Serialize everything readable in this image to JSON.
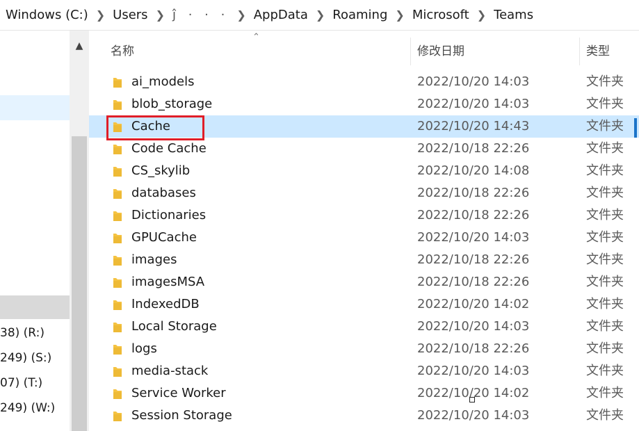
{
  "breadcrumb": [
    {
      "label": "Windows (C:)"
    },
    {
      "label": "Users"
    },
    {
      "label": "ĵ · · ·"
    },
    {
      "label": "AppData"
    },
    {
      "label": "Roaming"
    },
    {
      "label": "Microsoft"
    },
    {
      "label": "Teams"
    }
  ],
  "nav": {
    "items": [
      {
        "label": "38) (R:)"
      },
      {
        "label": "249) (S:)"
      },
      {
        "label": "07) (T:)"
      },
      {
        "label": "249) (W:)"
      }
    ]
  },
  "columns": {
    "name": "名称",
    "date": "修改日期",
    "type": "类型"
  },
  "files": [
    {
      "name": "ai_models",
      "date": "2022/10/20 14:03",
      "type": "文件夹"
    },
    {
      "name": "blob_storage",
      "date": "2022/10/20 14:03",
      "type": "文件夹"
    },
    {
      "name": "Cache",
      "date": "2022/10/20 14:43",
      "type": "文件夹"
    },
    {
      "name": "Code Cache",
      "date": "2022/10/18 22:26",
      "type": "文件夹"
    },
    {
      "name": "CS_skylib",
      "date": "2022/10/20 14:08",
      "type": "文件夹"
    },
    {
      "name": "databases",
      "date": "2022/10/18 22:26",
      "type": "文件夹"
    },
    {
      "name": "Dictionaries",
      "date": "2022/10/18 22:26",
      "type": "文件夹"
    },
    {
      "name": "GPUCache",
      "date": "2022/10/20 14:03",
      "type": "文件夹"
    },
    {
      "name": "images",
      "date": "2022/10/18 22:26",
      "type": "文件夹"
    },
    {
      "name": "imagesMSA",
      "date": "2022/10/18 22:26",
      "type": "文件夹"
    },
    {
      "name": "IndexedDB",
      "date": "2022/10/20 14:02",
      "type": "文件夹"
    },
    {
      "name": "Local Storage",
      "date": "2022/10/20 14:03",
      "type": "文件夹"
    },
    {
      "name": "logs",
      "date": "2022/10/18 22:26",
      "type": "文件夹"
    },
    {
      "name": "media-stack",
      "date": "2022/10/20 14:03",
      "type": "文件夹"
    },
    {
      "name": "Service Worker",
      "date": "2022/10/20 14:02",
      "type": "文件夹"
    },
    {
      "name": "Session Storage",
      "date": "2022/10/20 14:03",
      "type": "文件夹"
    }
  ],
  "colors": {
    "selection": "#cce8ff",
    "folder": "#f5c342",
    "highlight_box": "#e01e28"
  }
}
